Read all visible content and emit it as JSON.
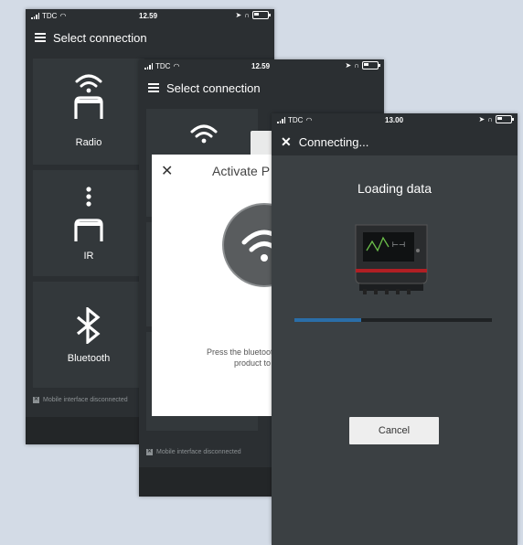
{
  "status_bar_1": {
    "carrier": "TDC",
    "time": "12.59"
  },
  "status_bar_2": {
    "carrier": "TDC",
    "time": "12.59"
  },
  "status_bar_3": {
    "carrier": "TDC",
    "time": "13.00"
  },
  "screen1": {
    "title": "Select connection",
    "tiles": [
      {
        "label": "Radio",
        "icon": "wifi-icon"
      },
      {
        "label": "IR",
        "icon": "ir-icon"
      },
      {
        "label": "Bluetooth",
        "icon": "bluetooth-icon"
      }
    ],
    "footer": "Mobile interface disconnected"
  },
  "screen2": {
    "title": "Select connection",
    "dialog": {
      "title": "Activate P",
      "body_line1": "Press the bluetooth",
      "body_line2": "product to c"
    },
    "footer": "Mobile interface disconnected"
  },
  "screen3": {
    "title": "Connecting...",
    "loading_text": "Loading data",
    "progress": 0.34,
    "cancel_label": "Cancel"
  },
  "colors": {
    "page_bg": "#d3dbe6",
    "phone_bg": "#2a2e31",
    "progress_fill": "#2a6ea8"
  }
}
